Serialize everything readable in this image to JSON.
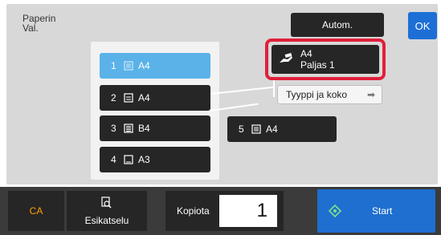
{
  "header": {
    "title": "Paperin\nVal.",
    "autom_label": "Autom.",
    "ok_label": "OK"
  },
  "trays": [
    {
      "num": "1",
      "size": "A4",
      "selected": true
    },
    {
      "num": "2",
      "size": "A4"
    },
    {
      "num": "3",
      "size": "B4"
    },
    {
      "num": "4",
      "size": "A3"
    },
    {
      "num": "5",
      "size": "A4"
    }
  ],
  "selected_paper": {
    "size": "A4",
    "type": "Paljas 1"
  },
  "type_size_button": {
    "label": "Tyyppi ja koko",
    "arrow": "➡"
  },
  "footer": {
    "ca_label": "CA",
    "preview_label": "Esikatselu",
    "copies_label": "Kopiota",
    "copies_value": "1",
    "start_label": "Start"
  },
  "colors": {
    "accent_blue": "#1e6fd0",
    "selected_tray": "#5ab2e8",
    "highlight_red": "#e0203a",
    "ca_orange": "#ffa000",
    "start_icon_green": "#7ee08a"
  }
}
